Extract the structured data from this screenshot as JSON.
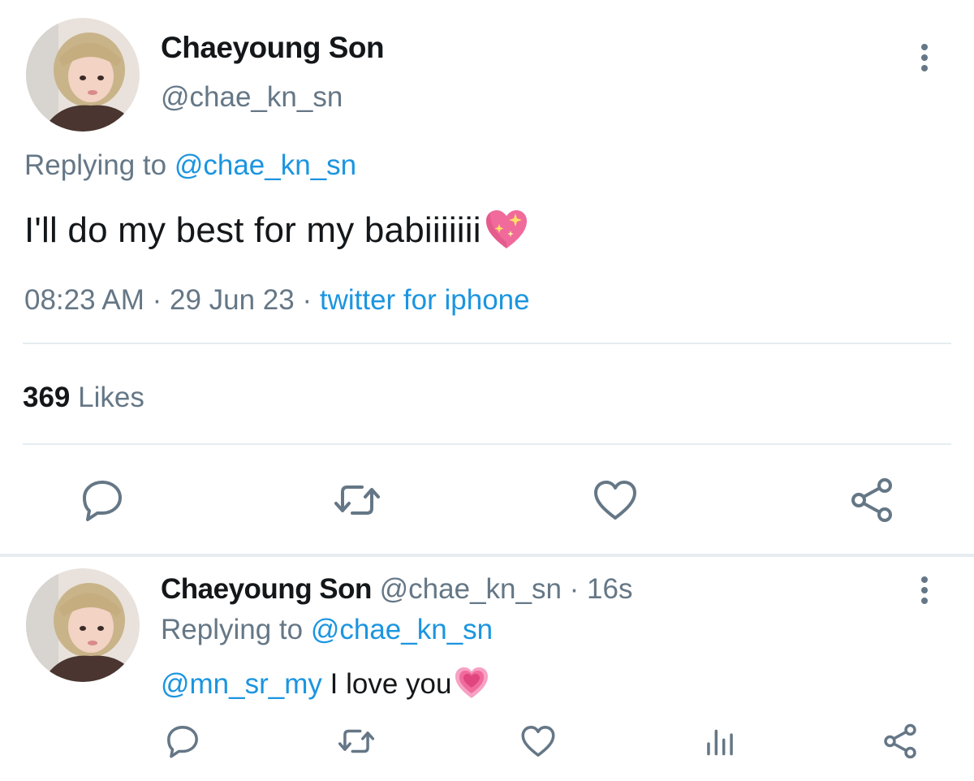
{
  "main_tweet": {
    "author_name": "Chaeyoung Son",
    "author_handle": "@chae_kn_sn",
    "replying_prefix": "Replying to",
    "replying_to": "@chae_kn_sn",
    "text": "I'll do my best for my babiiiiiii",
    "text_emoji": "sparkling-heart-icon",
    "time": "08:23 AM",
    "separator": " · ",
    "date": "29 Jun 23",
    "source": "twitter for iphone",
    "likes_count": "369",
    "likes_label": "Likes",
    "actions": [
      "reply-icon",
      "retweet-icon",
      "like-icon",
      "share-icon"
    ]
  },
  "reply_tweet": {
    "author_name": "Chaeyoung Son",
    "author_handle": "@chae_kn_sn",
    "age": "16s",
    "separator": " · ",
    "replying_prefix": "Replying to",
    "replying_to": "@chae_kn_sn",
    "mention": "@mn_sr_my",
    "text": "I love you",
    "text_emoji": "growing-heart-icon",
    "actions": [
      "reply-icon",
      "retweet-icon",
      "like-icon",
      "stats-icon",
      "share-icon"
    ]
  },
  "colors": {
    "text": "#14171a",
    "muted": "#657786",
    "link": "#1b95e0",
    "divider": "#e6ecf0",
    "heart_pink": "#f06a9b"
  }
}
